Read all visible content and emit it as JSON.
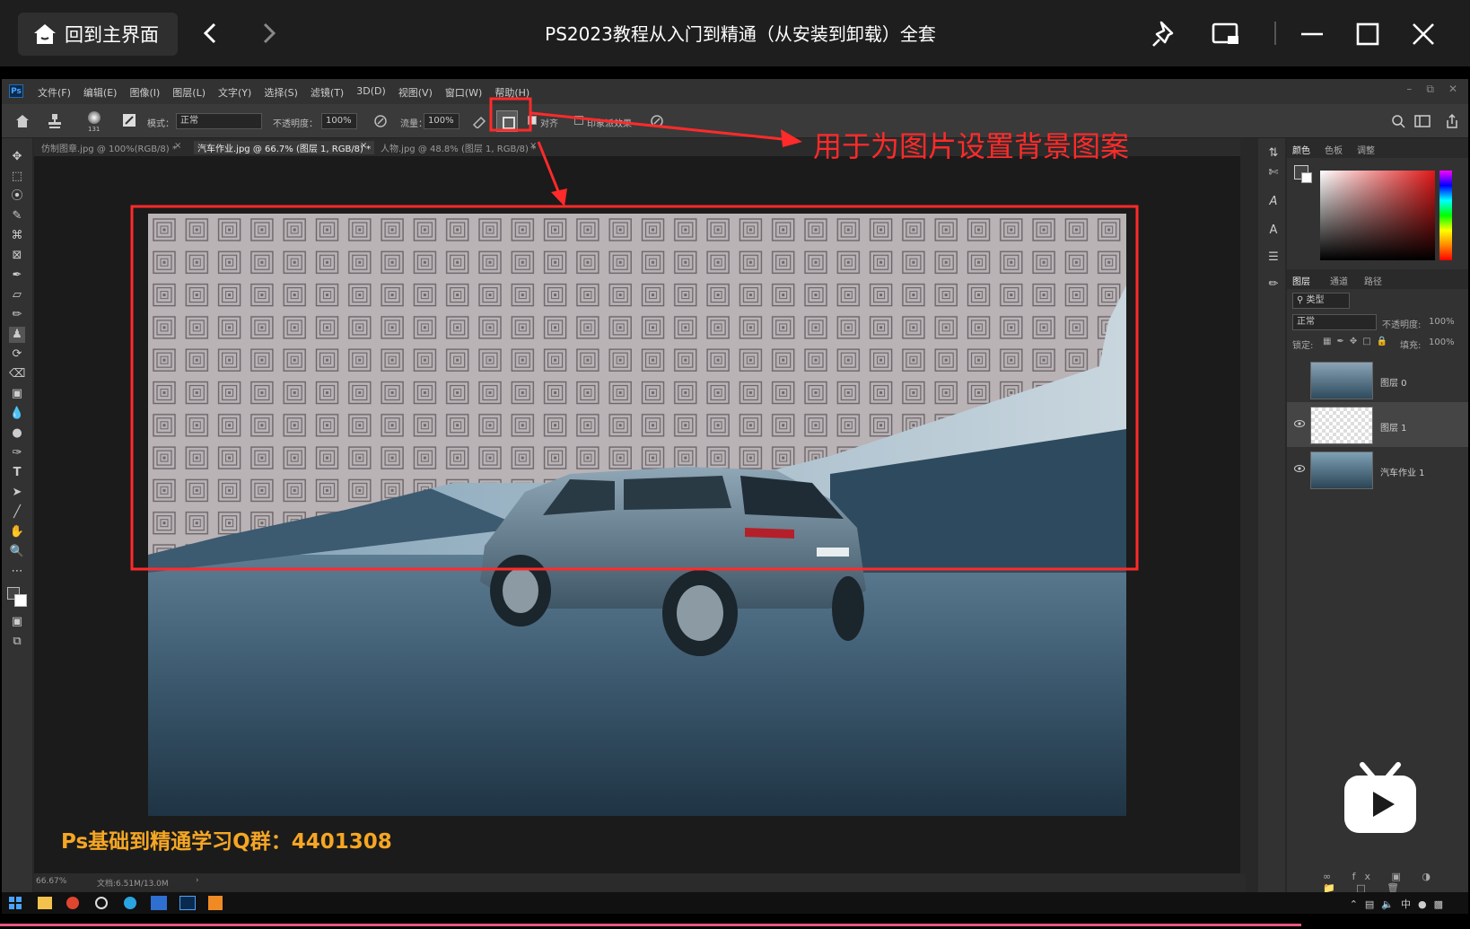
{
  "player": {
    "home_label": "回到主界面",
    "title": "PS2023教程从入门到精通（从安装到卸载）全套"
  },
  "ps": {
    "menu": [
      "文件(F)",
      "编辑(E)",
      "图像(I)",
      "图层(L)",
      "文字(Y)",
      "选择(S)",
      "滤镜(T)",
      "3D(D)",
      "视图(V)",
      "窗口(W)",
      "帮助(H)"
    ],
    "options": {
      "brush_size": "131",
      "mode_label": "模式：",
      "mode_value": "正常",
      "opacity_label": "不透明度：",
      "opacity_value": "100%",
      "flow_label": "流量：",
      "flow_value": "100%",
      "aligned_label": "对齐",
      "impressionist_label": "印象派效果"
    },
    "tabs": [
      "仿制图章.jpg @ 100%(RGB/8) *",
      "汽车作业.jpg @ 66.7% (图层 1, RGB/8) *",
      "人物.jpg @ 48.8% (图层 1, RGB/8) *"
    ],
    "color_panel_tabs": [
      "颜色",
      "色板",
      "调整"
    ],
    "layers_panel_tabs": [
      "图层",
      "通道",
      "路径"
    ],
    "layers_filter_label": "类型",
    "blend_mode": "正常",
    "opacity_label": "不透明度:",
    "opacity_value": "100%",
    "lock_label": "锁定:",
    "fill_label": "填充:",
    "fill_value": "100%",
    "layers": [
      {
        "name": "图层 0",
        "visible": false
      },
      {
        "name": "图层 1",
        "visible": true,
        "selected": true
      },
      {
        "name": "汽车作业 1",
        "visible": true
      }
    ],
    "status": {
      "zoom": "66.67%",
      "doc": "文档:6.51M/13.0M"
    }
  },
  "overlay": {
    "callout": "用于为图片设置背景图案",
    "caption": "Ps基础到精通学习Q群：4401308",
    "annotation_color": "#ff2a2a",
    "caption_color": "#f5a623"
  }
}
